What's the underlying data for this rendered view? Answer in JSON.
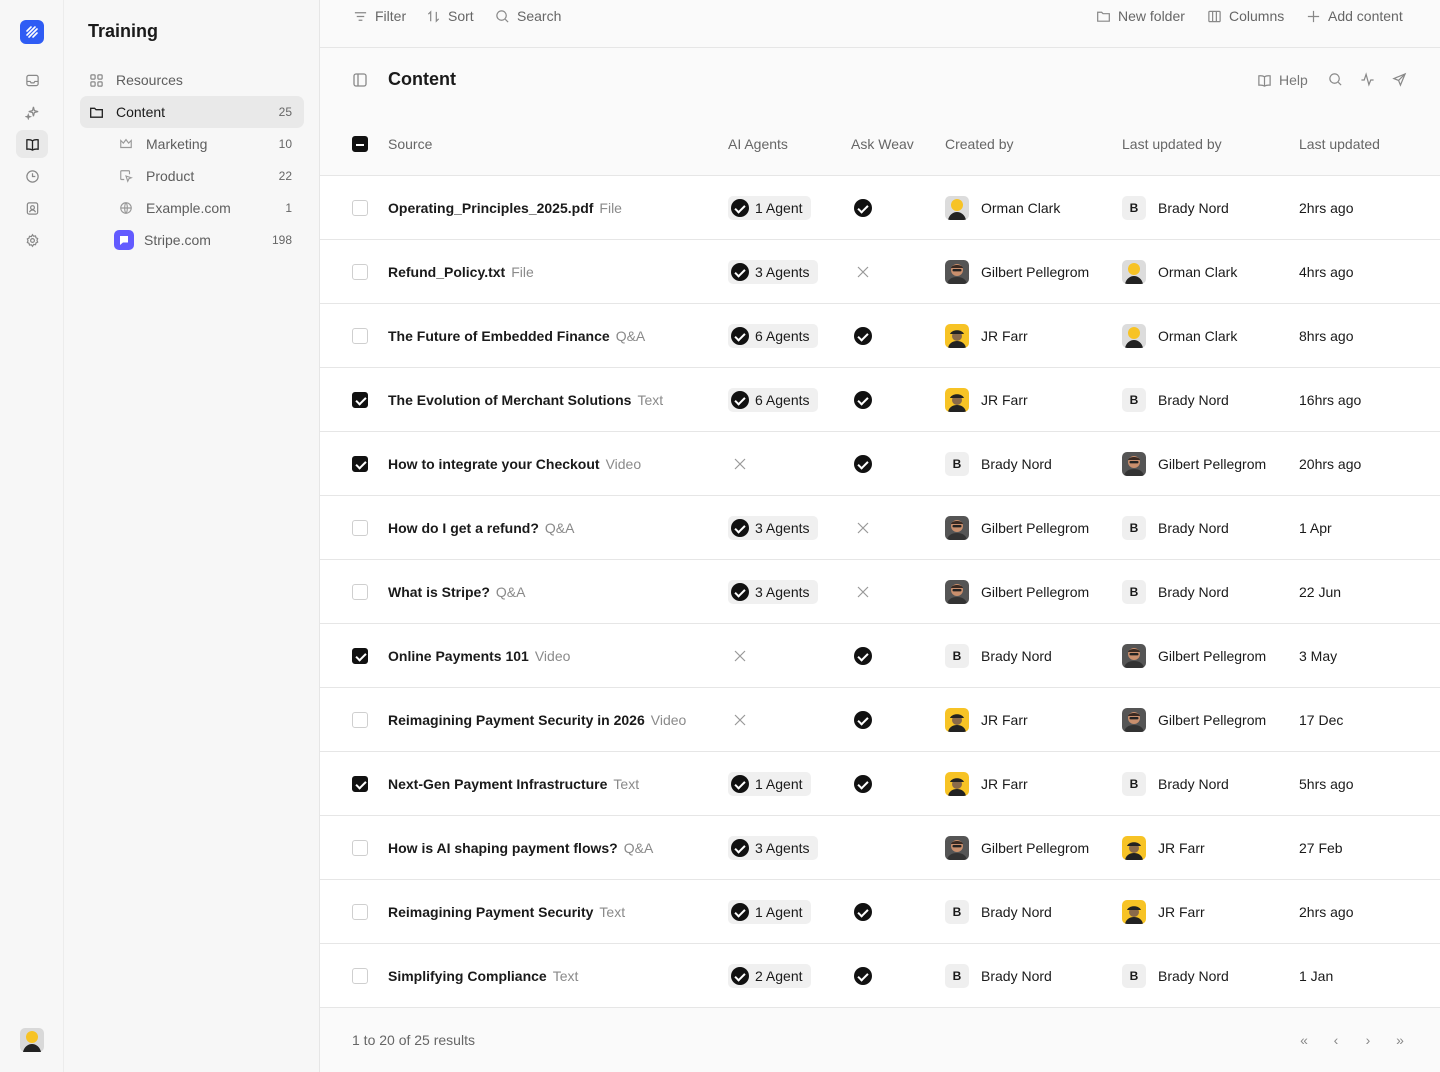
{
  "sidebar": {
    "title": "Training",
    "items": [
      {
        "label": "Resources",
        "count": "",
        "icon": "grid-icon"
      },
      {
        "label": "Content",
        "count": "25",
        "icon": "folder-icon"
      },
      {
        "label": "Marketing",
        "count": "10",
        "icon": "crown-icon"
      },
      {
        "label": "Product",
        "count": "22",
        "icon": "cursor-icon"
      },
      {
        "label": "Example.com",
        "count": "1",
        "icon": "globe-icon"
      },
      {
        "label": "Stripe.com",
        "count": "198",
        "icon": "stripe-logo-icon"
      }
    ]
  },
  "toolbar": {
    "filter": "Filter",
    "sort": "Sort",
    "search": "Search",
    "new_folder": "New folder",
    "columns": "Columns",
    "add_content": "Add content"
  },
  "content": {
    "title": "Content",
    "help": "Help"
  },
  "table": {
    "headers": {
      "source": "Source",
      "agents": "AI Agents",
      "ask": "Ask Weav",
      "created": "Created by",
      "updated_by": "Last updated by",
      "updated": "Last updated"
    },
    "rows": [
      {
        "name": "Operating_Principles_2025.pdf",
        "type": "File",
        "agents": "1 Agent",
        "ask": true,
        "created": "Orman Clark",
        "created_av": "orman",
        "updated_by": "Brady Nord",
        "updated_by_av": "brady",
        "updated": "2hrs ago",
        "checked": false
      },
      {
        "name": "Refund_Policy.txt",
        "type": "File",
        "agents": "3 Agents",
        "ask": false,
        "created": "Gilbert Pellegrom",
        "created_av": "gilbert",
        "updated_by": "Orman Clark",
        "updated_by_av": "orman",
        "updated": "4hrs ago",
        "checked": false
      },
      {
        "name": "The Future of Embedded Finance",
        "type": "Q&A",
        "agents": "6 Agents",
        "ask": true,
        "created": "JR Farr",
        "created_av": "jr",
        "updated_by": "Orman Clark",
        "updated_by_av": "orman",
        "updated": "8hrs ago",
        "checked": false
      },
      {
        "name": "The Evolution of Merchant Solutions",
        "type": "Text",
        "agents": "6 Agents",
        "ask": true,
        "created": "JR Farr",
        "created_av": "jr",
        "updated_by": "Brady Nord",
        "updated_by_av": "brady",
        "updated": "16hrs ago",
        "checked": true
      },
      {
        "name": "How to integrate your Checkout",
        "type": "Video",
        "agents": "",
        "ask": true,
        "created": "Brady Nord",
        "created_av": "brady",
        "updated_by": "Gilbert Pellegrom",
        "updated_by_av": "gilbert",
        "updated": "20hrs ago",
        "checked": true
      },
      {
        "name": "How do I get a refund?",
        "type": "Q&A",
        "agents": "3 Agents",
        "ask": false,
        "created": "Gilbert Pellegrom",
        "created_av": "gilbert",
        "updated_by": "Brady Nord",
        "updated_by_av": "brady",
        "updated": "1 Apr",
        "checked": false
      },
      {
        "name": "What is Stripe?",
        "type": "Q&A",
        "agents": "3 Agents",
        "ask": false,
        "created": "Gilbert Pellegrom",
        "created_av": "gilbert",
        "updated_by": "Brady Nord",
        "updated_by_av": "brady",
        "updated": "22 Jun",
        "checked": false
      },
      {
        "name": "Online Payments 101",
        "type": "Video",
        "agents": "",
        "ask": true,
        "created": "Brady Nord",
        "created_av": "brady",
        "updated_by": "Gilbert Pellegrom",
        "updated_by_av": "gilbert",
        "updated": "3 May",
        "checked": true
      },
      {
        "name": "Reimagining Payment Security in 2026",
        "type": "Video",
        "agents": "",
        "ask": true,
        "created": "JR Farr",
        "created_av": "jr",
        "updated_by": "Gilbert Pellegrom",
        "updated_by_av": "gilbert",
        "updated": "17 Dec",
        "checked": false
      },
      {
        "name": "Next-Gen Payment Infrastructure",
        "type": "Text",
        "agents": "1 Agent",
        "ask": true,
        "created": "JR Farr",
        "created_av": "jr",
        "updated_by": "Brady Nord",
        "updated_by_av": "brady",
        "updated": "5hrs ago",
        "checked": true
      },
      {
        "name": "How is AI shaping payment flows?",
        "type": "Q&A",
        "agents": "3 Agents",
        "ask": null,
        "created": "Gilbert Pellegrom",
        "created_av": "gilbert",
        "updated_by": "JR Farr",
        "updated_by_av": "jr",
        "updated": "27 Feb",
        "checked": false
      },
      {
        "name": "Reimagining Payment Security",
        "type": "Text",
        "agents": "1 Agent",
        "ask": true,
        "created": "Brady Nord",
        "created_av": "brady",
        "updated_by": "JR Farr",
        "updated_by_av": "jr",
        "updated": "2hrs ago",
        "checked": false
      },
      {
        "name": "Simplifying Compliance",
        "type": "Text",
        "agents": "2 Agent",
        "ask": true,
        "created": "Brady Nord",
        "created_av": "brady",
        "updated_by": "Brady Nord",
        "updated_by_av": "brady",
        "updated": "1 Jan",
        "checked": false
      }
    ]
  },
  "footer": {
    "results": "1 to 20 of 25 results"
  },
  "colors": {
    "brand": "#2f5cf4",
    "stripe": "#635bff",
    "avatar_yellow": "#f7c325"
  }
}
